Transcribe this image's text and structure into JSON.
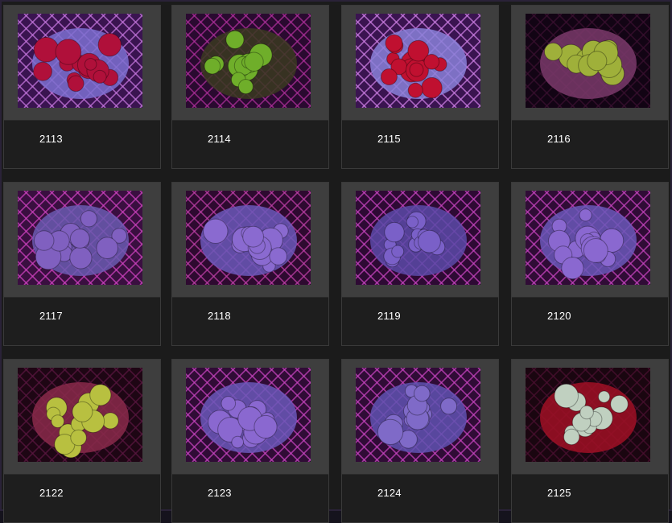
{
  "gallery": {
    "items": [
      {
        "id": "2113",
        "palette": {
          "bg": "#3a1450",
          "net": "#c879e0",
          "blob": "#b0103a",
          "base": "#7d6fd0"
        }
      },
      {
        "id": "2114",
        "palette": {
          "bg": "#2a0a30",
          "net": "#b0309c",
          "blob": "#6fae2a",
          "base": "#3a3a20"
        }
      },
      {
        "id": "2115",
        "palette": {
          "bg": "#3a1450",
          "net": "#d080e6",
          "blob": "#c01030",
          "base": "#8a80d8"
        }
      },
      {
        "id": "2116",
        "palette": {
          "bg": "#120414",
          "net": "#3a1030",
          "blob": "#9fb03a",
          "base": "#7a3a6a"
        }
      },
      {
        "id": "2117",
        "palette": {
          "bg": "#3a0f40",
          "net": "#d043c0",
          "blob": "#8060c0",
          "base": "#6a5ab0"
        }
      },
      {
        "id": "2118",
        "palette": {
          "bg": "#2e0a30",
          "net": "#c040a8",
          "blob": "#8a6ad0",
          "base": "#6a58b8"
        }
      },
      {
        "id": "2119",
        "palette": {
          "bg": "#2e0a34",
          "net": "#c845c0",
          "blob": "#7a60c8",
          "base": "#5a4aa8"
        }
      },
      {
        "id": "2120",
        "palette": {
          "bg": "#300c36",
          "net": "#c845c0",
          "blob": "#8a68d0",
          "base": "#6a58b8"
        }
      },
      {
        "id": "2122",
        "palette": {
          "bg": "#1e0614",
          "net": "#5a1640",
          "blob": "#b8c040",
          "base": "#8a2a4a"
        }
      },
      {
        "id": "2123",
        "palette": {
          "bg": "#300c36",
          "net": "#c845c0",
          "blob": "#8a68d0",
          "base": "#6a58b8"
        }
      },
      {
        "id": "2124",
        "palette": {
          "bg": "#300c36",
          "net": "#c845c0",
          "blob": "#7f6ac8",
          "base": "#5f52b0"
        }
      },
      {
        "id": "2125",
        "palette": {
          "bg": "#1a0610",
          "net": "#4a1030",
          "blob": "#c0d0c0",
          "base": "#a01024"
        }
      }
    ]
  }
}
